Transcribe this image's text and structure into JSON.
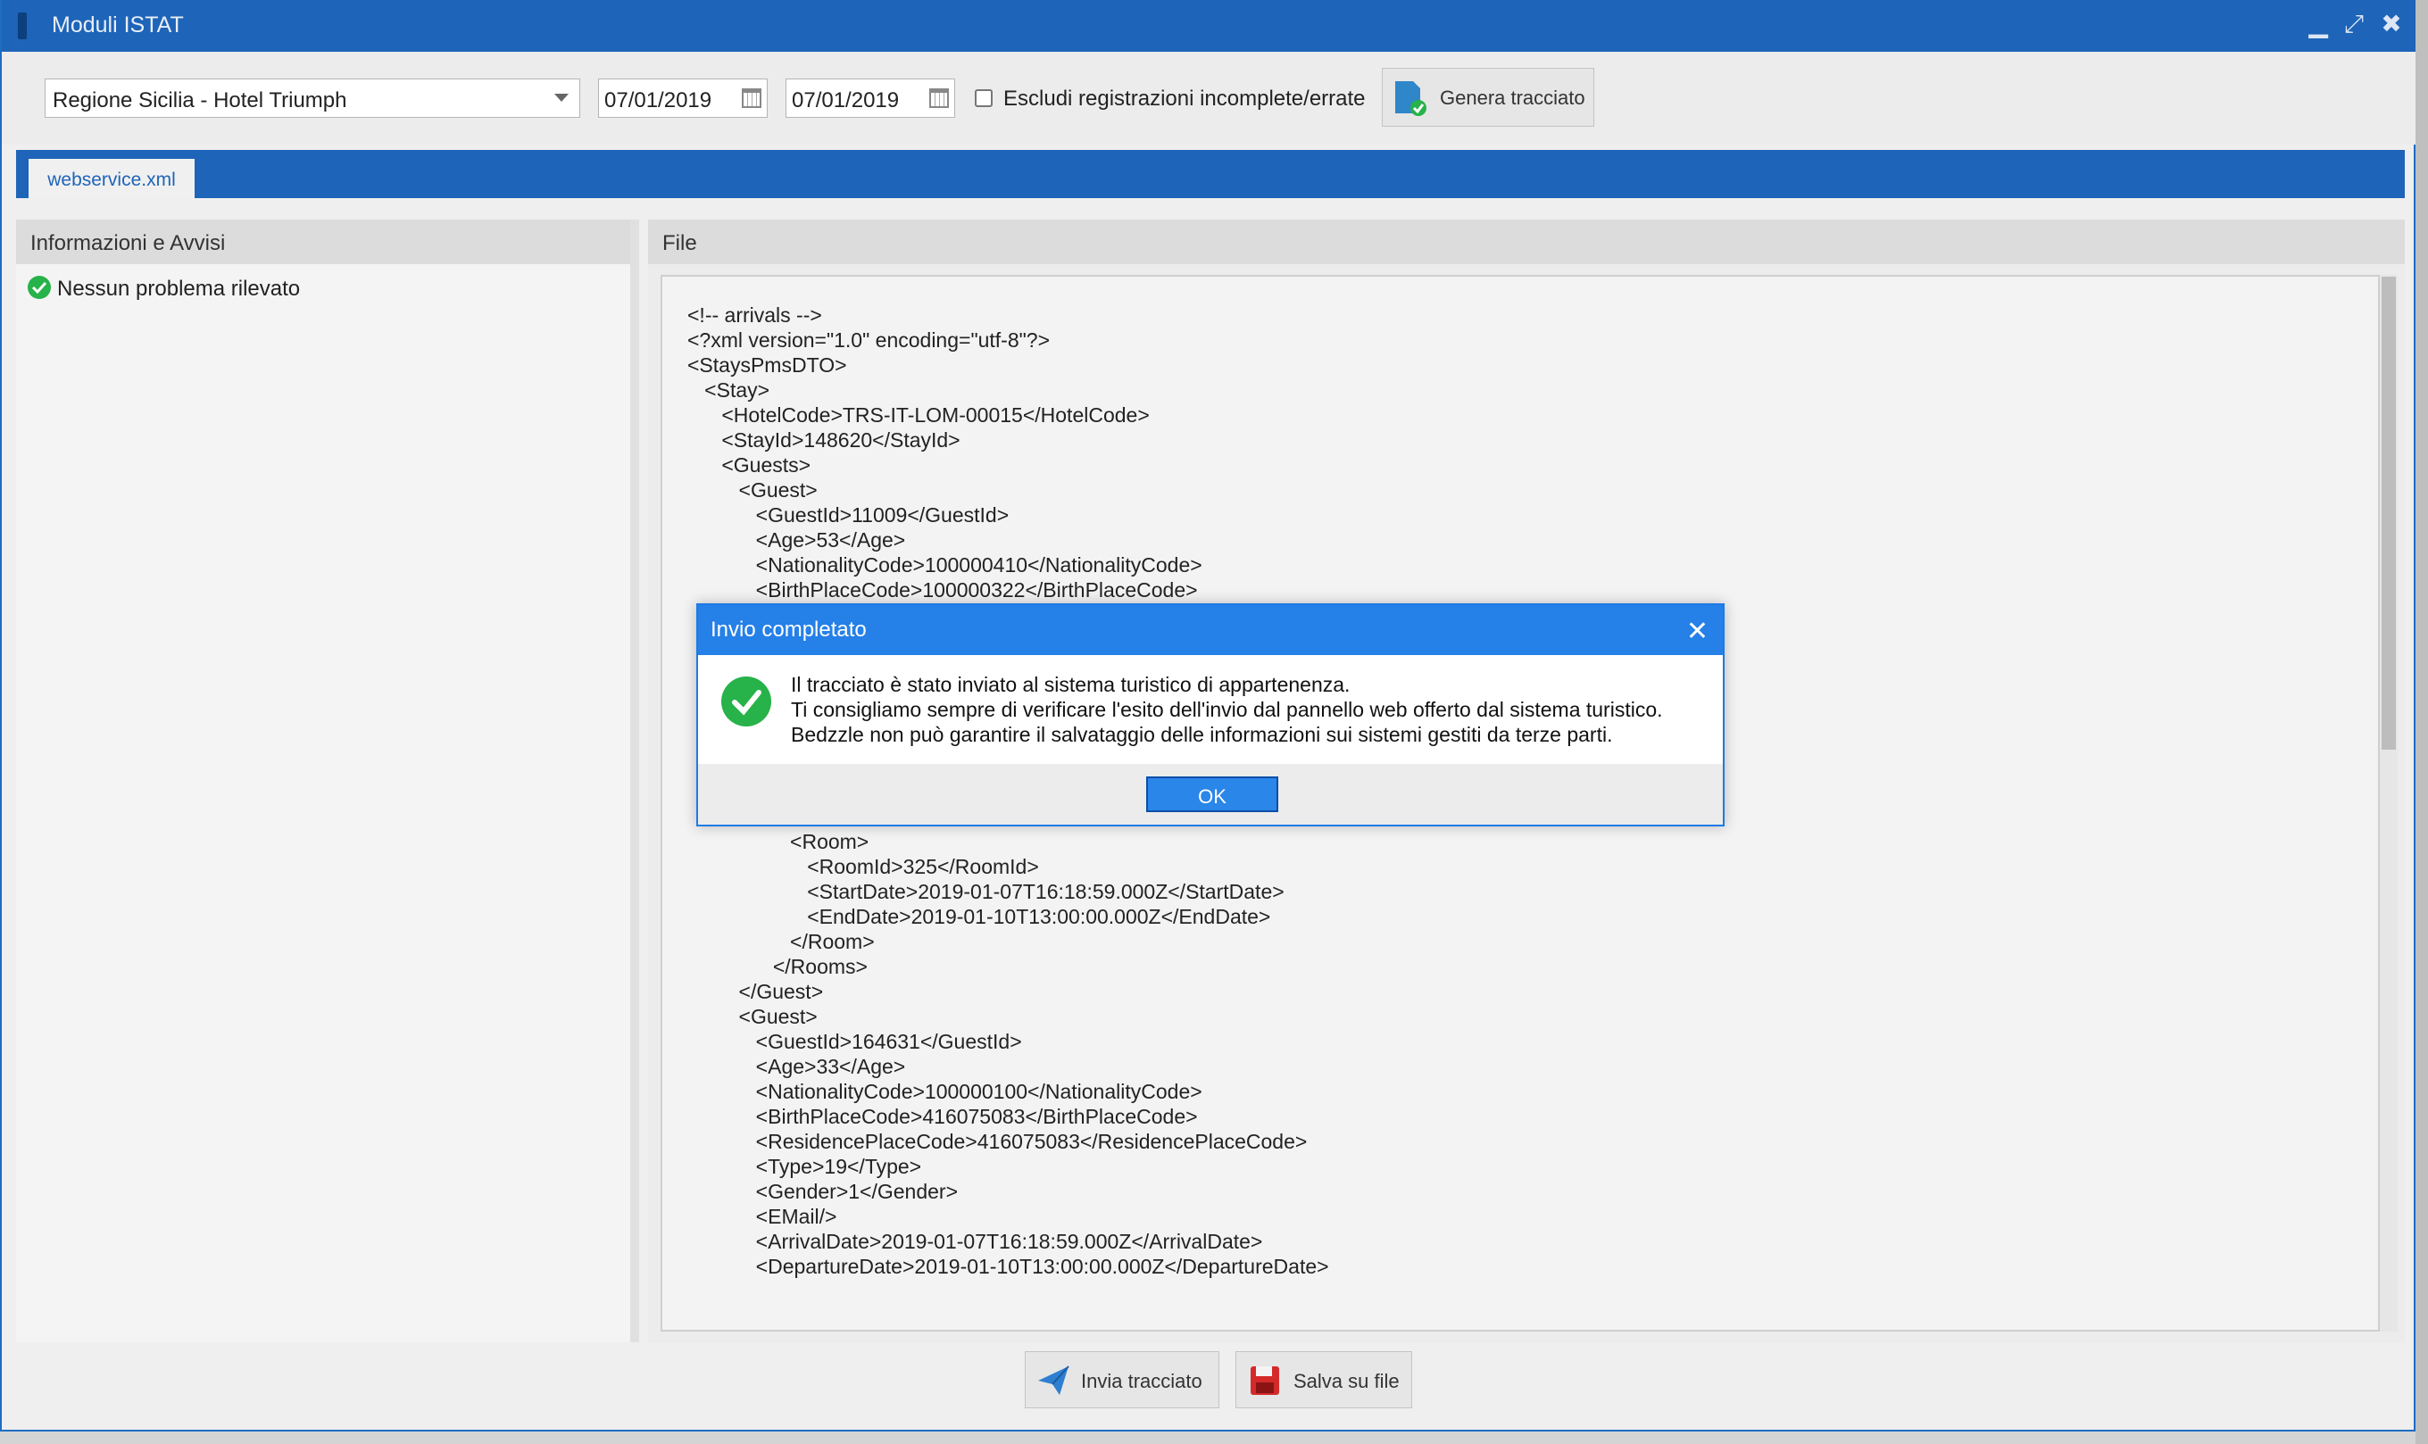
{
  "window": {
    "title": "Moduli ISTAT"
  },
  "toolbar": {
    "region_select": "Regione Sicilia - Hotel Triumph",
    "date_from": "07/01/2019",
    "date_to": "07/01/2019",
    "exclude_label": "Escludi registrazioni incomplete/errate",
    "generate_label": "Genera tracciato"
  },
  "tab": {
    "label": "webservice.xml"
  },
  "left_panel": {
    "title": "Informazioni e Avvisi",
    "status": "Nessun problema rilevato"
  },
  "right_panel": {
    "title": "File"
  },
  "code_top": [
    "<!-- arrivals -->",
    "<?xml version=\"1.0\" encoding=\"utf-8\"?>",
    "<StaysPmsDTO>",
    "   <Stay>",
    "      <HotelCode>TRS-IT-LOM-00015</HotelCode>",
    "      <StayId>148620</StayId>",
    "      <Guests>",
    "         <Guest>",
    "            <GuestId>11009</GuestId>",
    "            <Age>53</Age>",
    "            <NationalityCode>100000410</NationalityCode>",
    "            <BirthPlaceCode>100000322</BirthPlaceCode>"
  ],
  "code_bottom": [
    "                  <Room>",
    "                     <RoomId>325</RoomId>",
    "                     <StartDate>2019-01-07T16:18:59.000Z</StartDate>",
    "                     <EndDate>2019-01-10T13:00:00.000Z</EndDate>",
    "                  </Room>",
    "               </Rooms>",
    "         </Guest>",
    "         <Guest>",
    "            <GuestId>164631</GuestId>",
    "            <Age>33</Age>",
    "            <NationalityCode>100000100</NationalityCode>",
    "            <BirthPlaceCode>416075083</BirthPlaceCode>",
    "            <ResidencePlaceCode>416075083</ResidencePlaceCode>",
    "            <Type>19</Type>",
    "            <Gender>1</Gender>",
    "            <EMail/>",
    "            <ArrivalDate>2019-01-07T16:18:59.000Z</ArrivalDate>",
    "            <DepartureDate>2019-01-10T13:00:00.000Z</DepartureDate>"
  ],
  "footer": {
    "send_label": "Invia tracciato",
    "save_label": "Salva su file"
  },
  "dialog": {
    "title": "Invio completato",
    "line1": "Il tracciato è stato inviato al sistema turistico di appartenenza.",
    "line2": "Ti consigliamo sempre di verificare l'esito dell'invio dal pannello web offerto dal sistema turistico.",
    "line3": "Bedzzle non può garantire il salvataggio delle informazioni sui sistemi gestiti da terze parti.",
    "ok_label": "OK"
  },
  "colors": {
    "accent": "#1e64b8",
    "dialog_header": "#2580e8",
    "success": "#27b24a"
  }
}
